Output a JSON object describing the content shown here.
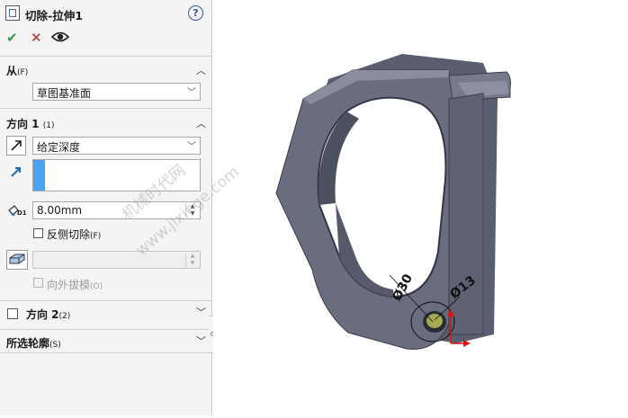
{
  "header": {
    "title": "切除-拉伸1",
    "help_icon": "?"
  },
  "actions": {
    "ok": "✔",
    "cancel": "✕"
  },
  "from": {
    "title": "从",
    "title_suffix": "(F)",
    "value": "草图基准面"
  },
  "direction1": {
    "title": "方向 1",
    "title_suffix": "(1)",
    "end_condition": "给定深度",
    "depth": "8.00mm",
    "depth_icon_label": "D1",
    "flip_side_label": "反侧切除",
    "flip_side_suffix": "(F)",
    "draft_outward_label": "向外拔模",
    "draft_outward_suffix": "(O)"
  },
  "direction2": {
    "title": "方向 2",
    "title_suffix": "(2)"
  },
  "selected_contours": {
    "title": "所选轮廓",
    "title_suffix": "(S)"
  },
  "dimensions": {
    "d30": "Ø30",
    "d13": "Ø13"
  },
  "watermark": {
    "line1": "机械时代网",
    "line2": "www.jixiege.com"
  },
  "colors": {
    "accent_blue": "#4aa3f0",
    "part_gray": "#686b7c",
    "ok_green": "#3a9a3a",
    "cancel_red": "#c0282a"
  }
}
